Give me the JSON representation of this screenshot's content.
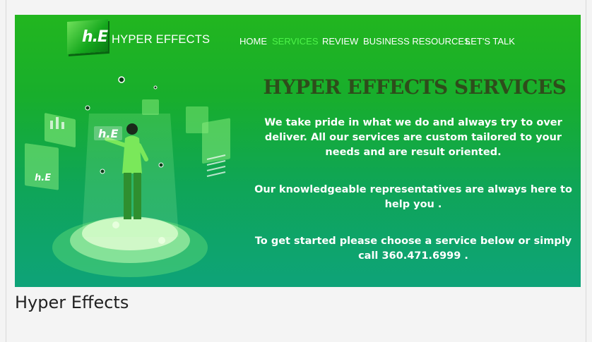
{
  "brand": {
    "logo_text": "h.E",
    "name": "HYPER EFFECTS"
  },
  "nav": {
    "items": [
      {
        "label": "HOME",
        "active": false
      },
      {
        "label": "SERVICES",
        "active": true
      },
      {
        "label": "REVIEW",
        "active": false
      },
      {
        "label": "BUSINESS RESOURCES",
        "active": false
      },
      {
        "label": "LET'S TALK",
        "active": false
      }
    ]
  },
  "hero": {
    "title": "HYPER EFFECTS SERVICES",
    "paragraph_1": "We take pride in what we do and always try to over deliver. All our services are custom tailored to your needs and are result oriented.",
    "paragraph_2": "Our knowledgeable representatives are always here to help you .",
    "paragraph_3": "To get started please choose a service below or simply call 360.471.6999 ."
  },
  "illustration": {
    "icons": [
      "person-hologram-illustration",
      "chart-panel-icon",
      "document-panel-icon",
      "logo-panel-icon"
    ]
  },
  "caption": "Hyper Effects",
  "colors": {
    "hero_top": "#22b61f",
    "hero_bottom": "#0ea379",
    "nav_active": "#4ef34a",
    "title": "#2e4d1b",
    "text": "#ffffff"
  }
}
